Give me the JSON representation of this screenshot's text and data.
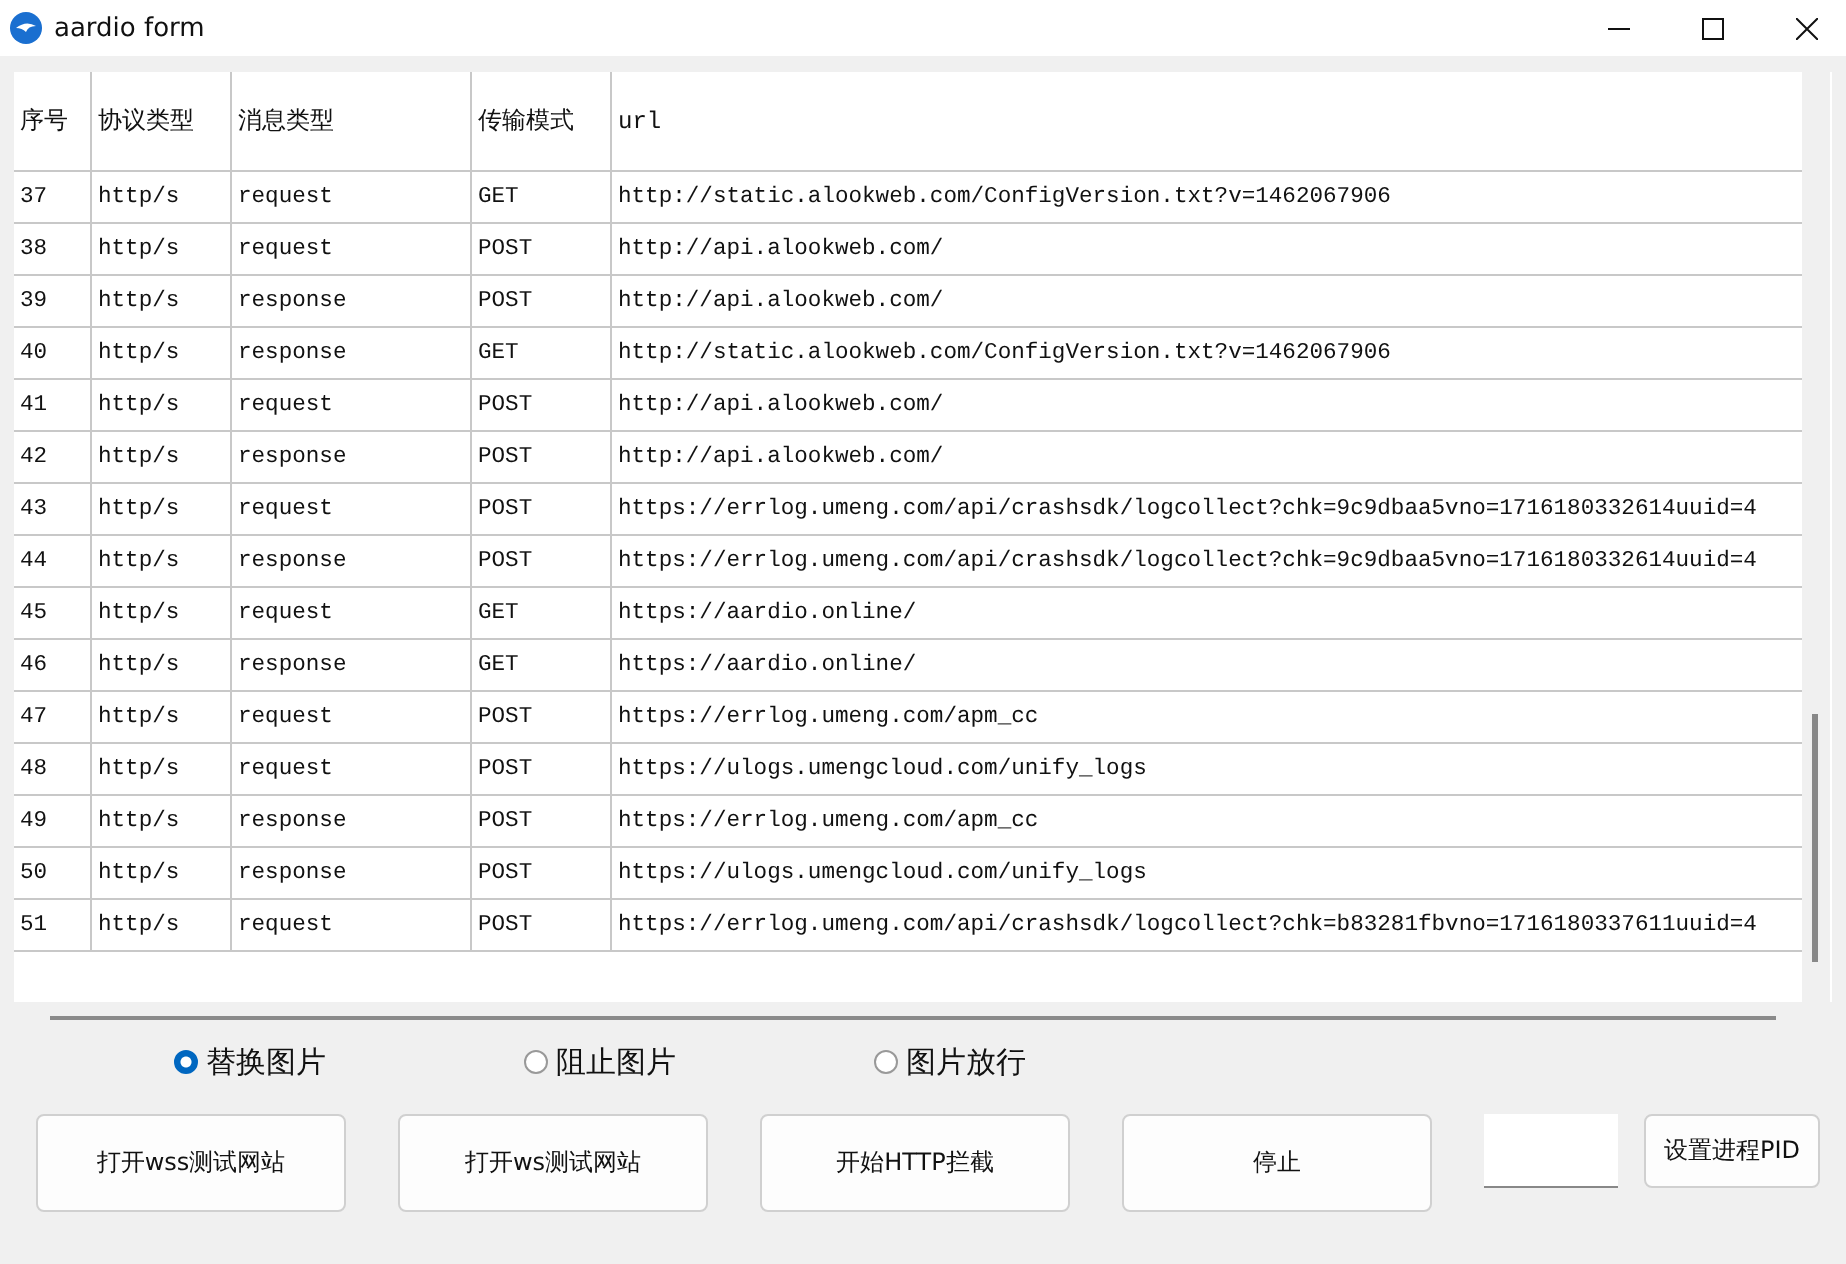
{
  "window": {
    "title": "aardio form"
  },
  "table": {
    "columns": [
      "序号",
      "协议类型",
      "消息类型",
      "传输模式",
      "url"
    ],
    "rows": [
      [
        "37",
        "http/s",
        "request",
        "GET",
        "http://static.alookweb.com/ConfigVersion.txt?v=1462067906"
      ],
      [
        "38",
        "http/s",
        "request",
        "POST",
        "http://api.alookweb.com/"
      ],
      [
        "39",
        "http/s",
        "response",
        "POST",
        "http://api.alookweb.com/"
      ],
      [
        "40",
        "http/s",
        "response",
        "GET",
        "http://static.alookweb.com/ConfigVersion.txt?v=1462067906"
      ],
      [
        "41",
        "http/s",
        "request",
        "POST",
        "http://api.alookweb.com/"
      ],
      [
        "42",
        "http/s",
        "response",
        "POST",
        "http://api.alookweb.com/"
      ],
      [
        "43",
        "http/s",
        "request",
        "POST",
        "https://errlog.umeng.com/api/crashsdk/logcollect?chk=9c9dbaa5vno=1716180332614uuid=4"
      ],
      [
        "44",
        "http/s",
        "response",
        "POST",
        "https://errlog.umeng.com/api/crashsdk/logcollect?chk=9c9dbaa5vno=1716180332614uuid=4"
      ],
      [
        "45",
        "http/s",
        "request",
        "GET",
        "https://aardio.online/"
      ],
      [
        "46",
        "http/s",
        "response",
        "GET",
        "https://aardio.online/"
      ],
      [
        "47",
        "http/s",
        "request",
        "POST",
        "https://errlog.umeng.com/apm_cc"
      ],
      [
        "48",
        "http/s",
        "request",
        "POST",
        "https://ulogs.umengcloud.com/unify_logs"
      ],
      [
        "49",
        "http/s",
        "response",
        "POST",
        "https://errlog.umeng.com/apm_cc"
      ],
      [
        "50",
        "http/s",
        "response",
        "POST",
        "https://ulogs.umengcloud.com/unify_logs"
      ],
      [
        "51",
        "http/s",
        "request",
        "POST",
        "https://errlog.umeng.com/api/crashsdk/logcollect?chk=b83281fbvno=1716180337611uuid=4"
      ]
    ]
  },
  "radios": [
    {
      "label": "替换图片",
      "selected": true
    },
    {
      "label": "阻止图片",
      "selected": false
    },
    {
      "label": "图片放行",
      "selected": false
    }
  ],
  "buttons": [
    "打开wss测试网站",
    "打开ws测试网站",
    "开始HTTP拦截",
    "停止"
  ],
  "pid_button": "设置进程PID"
}
